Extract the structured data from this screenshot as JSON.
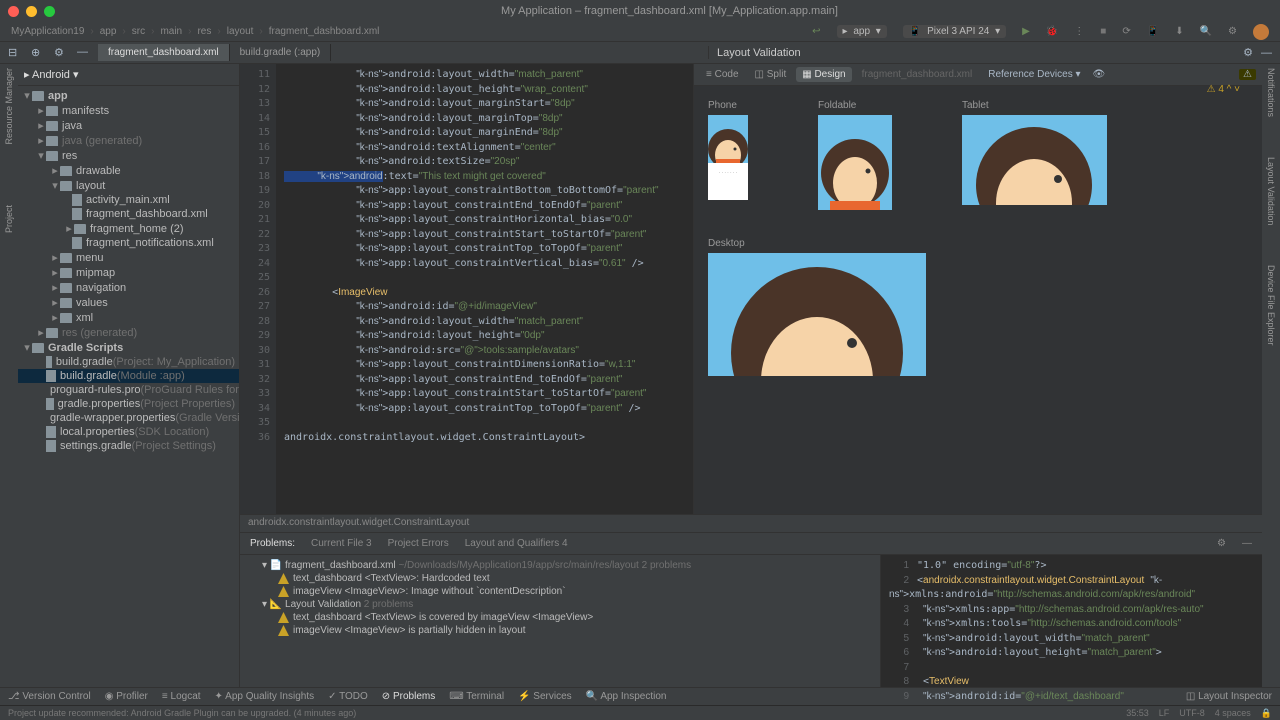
{
  "window_title": "My Application – fragment_dashboard.xml [My_Application.app.main]",
  "breadcrumb": [
    "MyApplication19",
    "app",
    "src",
    "main",
    "res",
    "layout",
    "fragment_dashboard.xml"
  ],
  "run_config": {
    "module": "app",
    "device": "Pixel 3 API 24"
  },
  "project_dropdown": "Android",
  "tree": {
    "app": "app",
    "manifests": "manifests",
    "java": "java",
    "java_gen": "java (generated)",
    "res": "res",
    "drawable": "drawable",
    "layout": "layout",
    "activity_main": "activity_main.xml",
    "fragment_dashboard": "fragment_dashboard.xml",
    "fragment_home": "fragment_home (2)",
    "fragment_notifications": "fragment_notifications.xml",
    "menu": "menu",
    "mipmap": "mipmap",
    "navigation": "navigation",
    "values": "values",
    "xml": "xml",
    "res_gen": "res (generated)",
    "gradle_scripts": "Gradle Scripts",
    "build_gradle_proj": "build.gradle",
    "build_gradle_proj_hint": "(Project: My_Application)",
    "build_gradle_mod": "build.gradle",
    "build_gradle_mod_hint": "(Module :app)",
    "proguard": "proguard-rules.pro",
    "proguard_hint": "(ProGuard Rules for \":app\")",
    "gradle_props": "gradle.properties",
    "gradle_props_hint": "(Project Properties)",
    "gradle_wrapper": "gradle-wrapper.properties",
    "gradle_wrapper_hint": "(Gradle Version)",
    "local_props": "local.properties",
    "local_props_hint": "(SDK Location)",
    "settings_gradle": "settings.gradle",
    "settings_gradle_hint": "(Project Settings)"
  },
  "open_tabs": [
    {
      "label": "fragment_dashboard.xml",
      "active": true
    },
    {
      "label": "build.gradle (:app)",
      "active": false
    }
  ],
  "validation": {
    "title": "Layout Validation",
    "modes": {
      "code": "Code",
      "split": "Split",
      "design": "Design"
    },
    "file": "fragment_dashboard.xml",
    "ref": "Reference Devices",
    "phone": "Phone",
    "foldable": "Foldable",
    "tablet": "Tablet",
    "desktop": "Desktop"
  },
  "inspection_badge": "4",
  "code": {
    "first_line": 11,
    "lines": [
      "            android:layout_width=\"match_parent\"",
      "            android:layout_height=\"wrap_content\"",
      "            android:layout_marginStart=\"8dp\"",
      "            android:layout_marginTop=\"8dp\"",
      "            android:layout_marginEnd=\"8dp\"",
      "            android:textAlignment=\"center\"",
      "            android:textSize=\"20sp\"",
      "            android:text=\"This text might get covered\"",
      "            app:layout_constraintBottom_toBottomOf=\"parent\"",
      "            app:layout_constraintEnd_toEndOf=\"parent\"",
      "            app:layout_constraintHorizontal_bias=\"0.0\"",
      "            app:layout_constraintStart_toStartOf=\"parent\"",
      "            app:layout_constraintTop_toTopOf=\"parent\"",
      "            app:layout_constraintVertical_bias=\"0.61\" />",
      "",
      "        <ImageView",
      "            android:id=\"@+id/imageView\"",
      "            android:layout_width=\"match_parent\"",
      "            android:layout_height=\"0dp\"",
      "            android:src=\"@tools:sample/avatars\"",
      "            app:layout_constraintDimensionRatio=\"w,1:1\"",
      "            app:layout_constraintEnd_toEndOf=\"parent\"",
      "            app:layout_constraintStart_toStartOf=\"parent\"",
      "            app:layout_constraintTop_toTopOf=\"parent\" />",
      "",
      "</androidx.constraintlayout.widget.ConstraintLayout>"
    ],
    "crumb": "androidx.constraintlayout.widget.ConstraintLayout"
  },
  "problems": {
    "tabs": {
      "problems": "Problems:",
      "current": "Current File",
      "count_current": "3",
      "project_errors": "Project Errors",
      "layout": "Layout and Qualifiers",
      "count_layout": "4"
    },
    "group1": {
      "file": "fragment_dashboard.xml",
      "path": "~/Downloads/MyApplication19/app/src/main/res/layout",
      "suffix": "2 problems",
      "items": [
        "text_dashboard <TextView>: Hardcoded text",
        "imageView <ImageView>: Image without `contentDescription`"
      ]
    },
    "group2": {
      "file": "Layout Validation",
      "suffix": "2 problems",
      "items": [
        "text_dashboard <TextView> is covered by imageView <ImageView>",
        "imageView <ImageView> is partially hidden in layout"
      ]
    },
    "snippet": [
      "<?xml version=\"1.0\" encoding=\"utf-8\"?>",
      "<androidx.constraintlayout.widget.ConstraintLayout xmlns:android=\"http://schemas.android.com/apk/res/android\"",
      "    xmlns:app=\"http://schemas.android.com/apk/res-auto\"",
      "    xmlns:tools=\"http://schemas.android.com/tools\"",
      "    android:layout_width=\"match_parent\"",
      "    android:layout_height=\"match_parent\">",
      "",
      "    <TextView",
      "        android:id=\"@+id/text_dashboard\""
    ]
  },
  "bottom": {
    "vc": "Version Control",
    "profiler": "Profiler",
    "logcat": "Logcat",
    "appq": "App Quality Insights",
    "todo": "TODO",
    "problems": "Problems",
    "terminal": "Terminal",
    "services": "Services",
    "appinsp": "App Inspection",
    "layoutinsp": "Layout Inspector"
  },
  "status": {
    "msg": "Project update recommended: Android Gradle Plugin can be upgraded. (4 minutes ago)",
    "pos": "35:53",
    "le": "LF",
    "enc": "UTF-8",
    "indent": "4 spaces"
  }
}
